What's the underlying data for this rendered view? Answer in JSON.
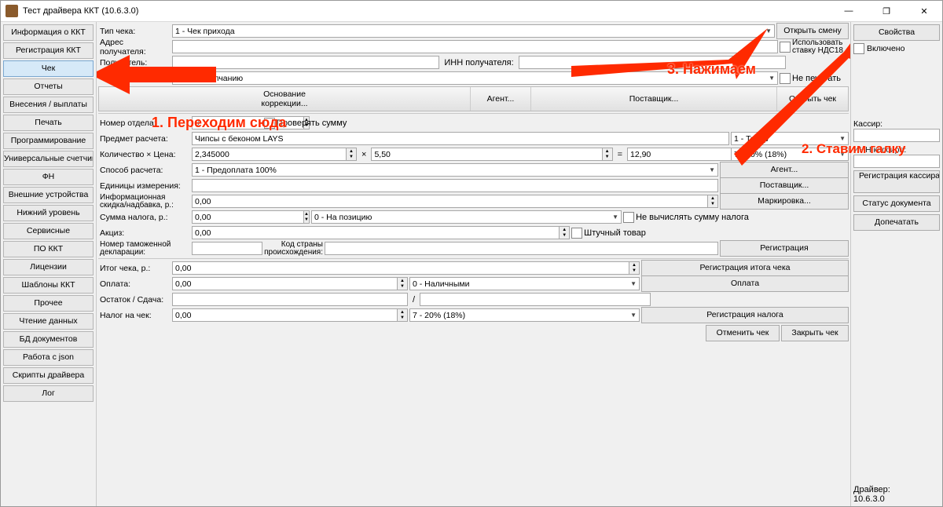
{
  "window": {
    "title": "Тест драйвера ККТ (10.6.3.0)"
  },
  "winbtns": {
    "min": "—",
    "max": "❐",
    "close": "✕"
  },
  "nav": [
    "Информация о ККТ",
    "Регистрация ККТ",
    "Чек",
    "Отчеты",
    "Внесения / выплаты",
    "Печать",
    "Программирование",
    "Универсальные счетчики",
    "ФН",
    "Внешние устройства",
    "Нижний уровень",
    "Сервисные",
    "ПО ККТ",
    "Лицензии",
    "Шаблоны ККТ",
    "Прочее",
    "Чтение данных",
    "БД документов",
    "Работа с json",
    "Скрипты драйвера",
    "Лог"
  ],
  "nav_active": 2,
  "labels": {
    "tip_cheka": "Тип чека:",
    "adres": "Адрес получателя:",
    "poluchatel": "Получатель:",
    "inn_poluch": "ИНН получателя:",
    "nomer_otdela": "Номер отдела:",
    "predmet": "Предмет расчета:",
    "kol_cena": "Количество × Цена:",
    "sposob": "Способ расчета:",
    "edinicy": "Единицы измерения:",
    "info_skidka": "Информационная скидка/надбавка, р.:",
    "summa_naloga": "Сумма налога, р.:",
    "akciz": "Акциз:",
    "nomer_tam": "Номер таможенной декларации:",
    "kod_strany": "Код страны происхождения:",
    "itog": "Итог чека, р.:",
    "oplata": "Оплата:",
    "ostatok": "Остаток / Сдача:",
    "nalog_chek": "Налог на чек:",
    "x": "×",
    "eq": "=",
    "slash": "/"
  },
  "values": {
    "tip_cheka": "1 - Чек прихода",
    "default_select": "0 - По умолчанию",
    "predmet": "Чипсы с беконом LAYS",
    "tovar": "1 - Товар",
    "kol": "2,345000",
    "cena": "5,50",
    "summa": "12,90",
    "nalog_rate": "7 - 20% (18%)",
    "sposob": "1 - Предоплата 100%",
    "skidka": "0,00",
    "sum_nalog": "0,00",
    "akciz": "0,00",
    "na_poziciyu": "0 - На позицию",
    "itog": "0,00",
    "oplata_v": "0,00",
    "oplata_type": "0 - Наличными",
    "nalog_chek_v": "0,00",
    "nalog_chek_rate": "7 - 20% (18%)",
    "nomer_otdela": "0"
  },
  "buttons": {
    "otkryt_smenu": "Открыть смену",
    "osnovanie": "Основание",
    "korrekcii": "коррекции...",
    "agent": "Агент...",
    "postavshik": "Поставщик...",
    "otkryt_chek": "Открыть чек",
    "agent2": "Агент...",
    "postavshik2": "Поставщик...",
    "markirovka": "Маркировка...",
    "registraciya": "Регистрация",
    "reg_itoga": "Регистрация итога чека",
    "oplata": "Оплата",
    "reg_naloga": "Регистрация налога",
    "otmenit": "Отменить чек",
    "zakryt": "Закрыть чек",
    "proveryat": "Проверять сумму"
  },
  "checkboxes": {
    "ispolzovat": "Использовать ставку НДС18",
    "ne_pechatat": "Не печатать",
    "ne_vychislyat": "Не вычислять сумму налога",
    "shtuchnyj": "Штучный товар",
    "vklyucheno": "Включено"
  },
  "right": {
    "svoistva": "Свойства",
    "kassir": "Кассир:",
    "inn_kassira": "ИНН кассира:",
    "reg_kassira": "Регистрация кассира",
    "status": "Статус документа",
    "dopechat": "Допечатать",
    "driver_lbl": "Драйвер:",
    "driver_ver": "10.6.3.0"
  },
  "annotations": {
    "a1": "1. Переходим сюда",
    "a2": "2. Ставим галку",
    "a3": "3. Нажимаем"
  }
}
